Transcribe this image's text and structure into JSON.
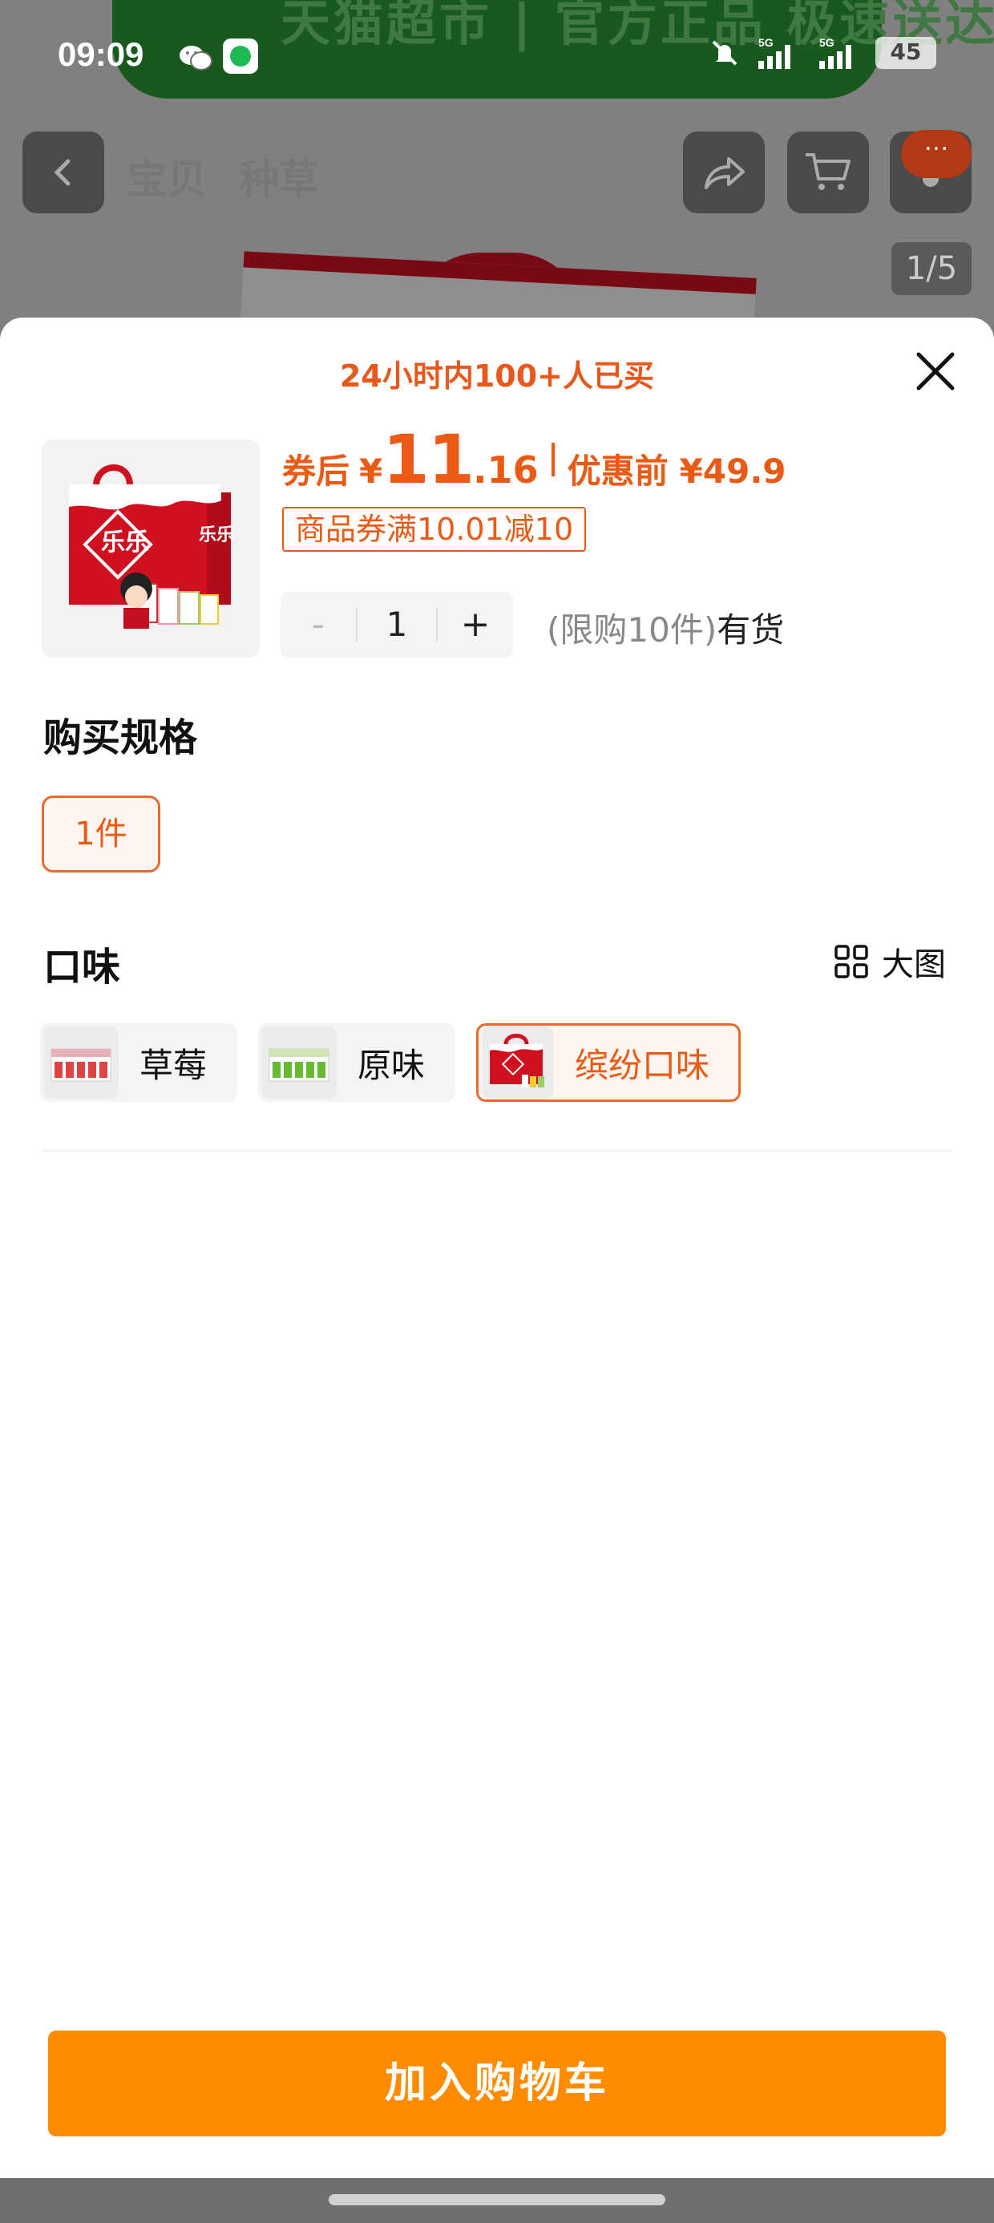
{
  "status_bar": {
    "time": "09:09",
    "battery": "45",
    "signal_1": "5G",
    "signal_2": "5G"
  },
  "background_page": {
    "banner_text": "天猫超市 | 官方正品 极速送达",
    "tabs": [
      "宝贝",
      "种草"
    ],
    "page_counter": "1/5",
    "more_badge": "···"
  },
  "sheet": {
    "sold_text": "24小时内100+人已买",
    "price": {
      "after_label": "券后",
      "currency": "¥",
      "integer": "11",
      "decimal": ".16",
      "before_label": "优惠前",
      "before_value": "¥49.9"
    },
    "coupon": "商品券满10.01减10",
    "quantity": {
      "minus": "-",
      "value": "1",
      "plus": "+"
    },
    "stock": {
      "limit": "(限购10件)",
      "status": "有货"
    },
    "spec": {
      "title": "购买规格",
      "options": [
        {
          "label": "1件",
          "selected": true
        }
      ]
    },
    "flavor": {
      "title": "口味",
      "big_pic_label": "大图",
      "options": [
        {
          "label": "草莓",
          "selected": false
        },
        {
          "label": "原味",
          "selected": false
        },
        {
          "label": "缤纷口味",
          "selected": true
        }
      ]
    },
    "add_to_cart": "加入购物车"
  },
  "colors": {
    "accent": "#ea5a14",
    "cart_button": "#ff8c00",
    "product_red": "#d01020"
  },
  "icons": [
    "back-icon",
    "share-icon",
    "cart-icon",
    "more-icon",
    "close-icon",
    "grid-icon",
    "wechat-icon",
    "mute-icon",
    "signal-icon",
    "battery-icon"
  ]
}
